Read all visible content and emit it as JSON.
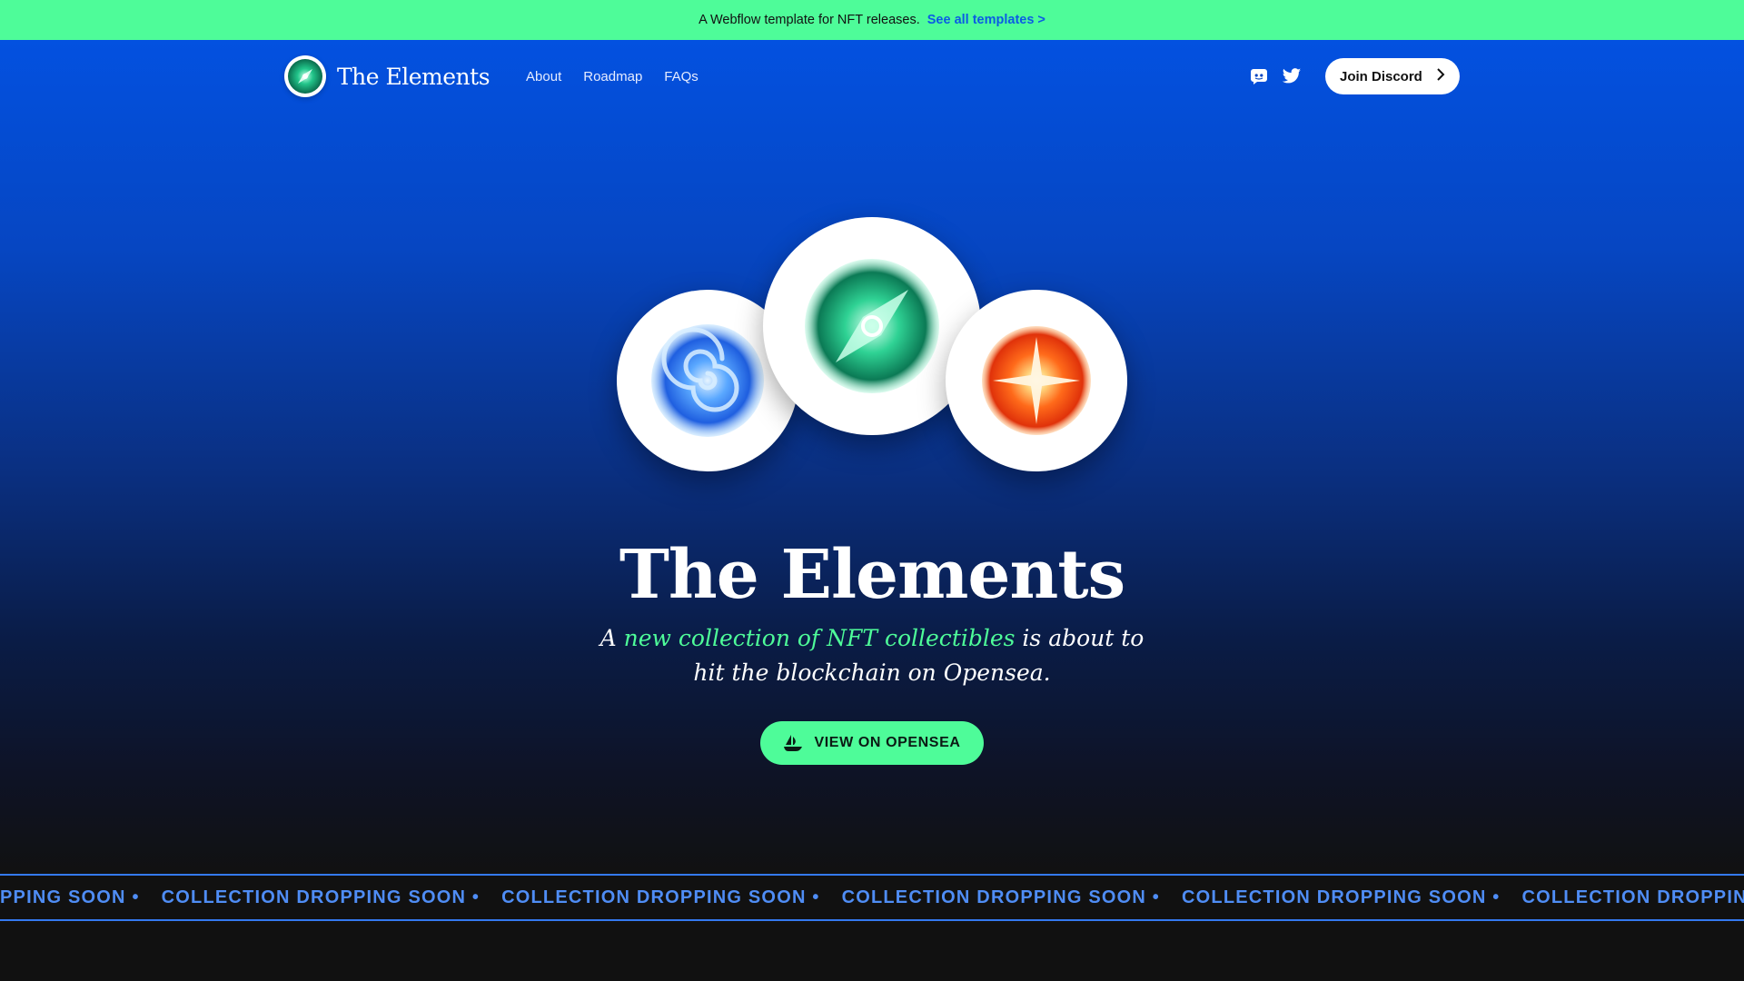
{
  "banner": {
    "text": "A Webflow template for NFT releases.",
    "link": "See all templates >"
  },
  "nav": {
    "brand": "The Elements",
    "links": [
      "About",
      "Roadmap",
      "FAQs"
    ],
    "social": [
      "discord-icon",
      "twitter-icon"
    ],
    "join_label": "Join Discord"
  },
  "hero": {
    "title": "The Elements",
    "subtitle_pre": "A ",
    "subtitle_highlight": "new collection of NFT collectibles",
    "subtitle_post": " is about to hit the blockchain on Opensea.",
    "cta_label": "VIEW ON OPENSEA"
  },
  "orbs": [
    "water-orb",
    "air-orb",
    "fire-orb"
  ],
  "ticker": {
    "text": "COLLECTION DROPPING SOON •",
    "first_partial": "PPING SOON •"
  },
  "colors": {
    "accent": "#4efc99",
    "banner_link": "#0b5ce4",
    "ticker": "#4f8df5",
    "hero_top": "#0351e0",
    "background": "#111111"
  }
}
